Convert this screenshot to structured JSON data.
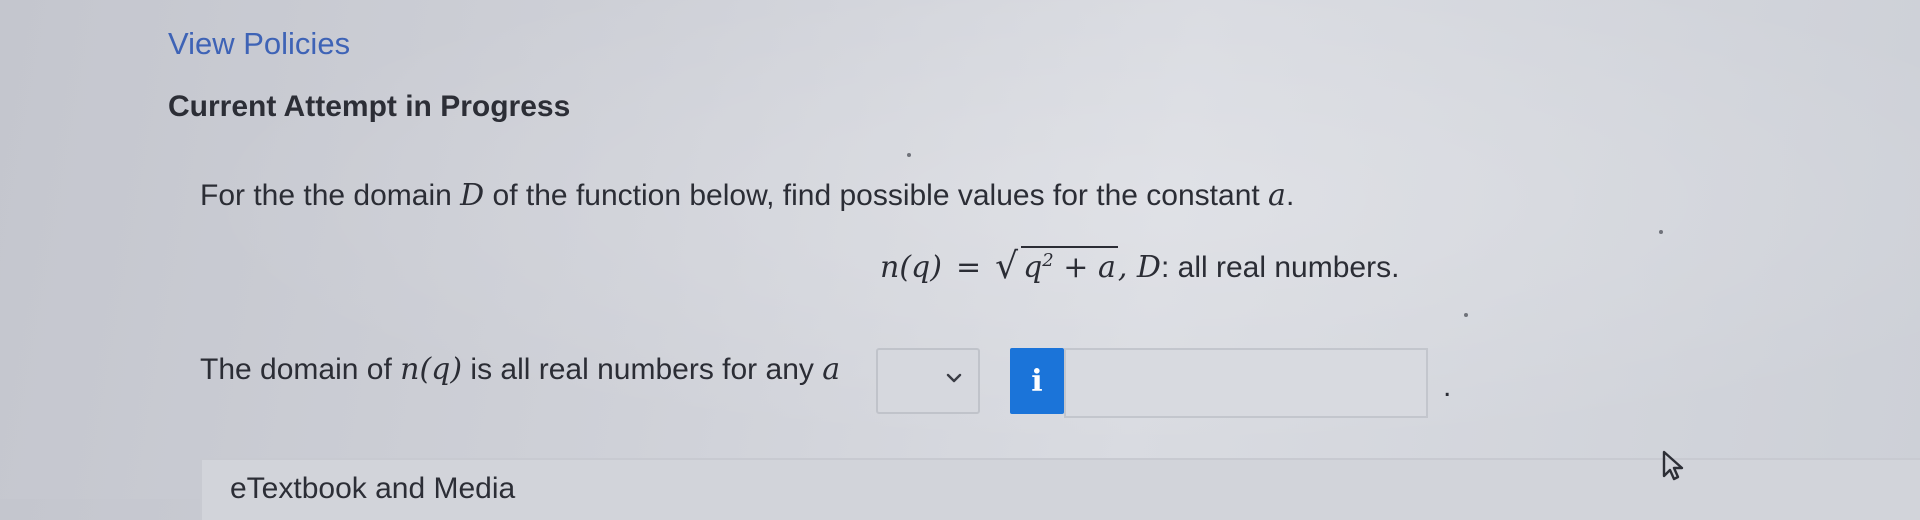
{
  "header": {
    "view_policies_link": "View Policies",
    "attempt_heading": "Current Attempt in Progress"
  },
  "question": {
    "prompt_before_D": "For the the domain ",
    "prompt_var_D": "D",
    "prompt_middle": " of the function below, find possible values for the constant ",
    "prompt_var_a": "a",
    "prompt_end": ".",
    "formula_lhs": "n(q)",
    "formula_eq": "=",
    "radicand_base": "q",
    "radicand_exp": "2",
    "radicand_rest": " + a",
    "formula_domain_var": ", D",
    "formula_domain_text": ": all real numbers."
  },
  "answer": {
    "statement_before": "The domain of ",
    "statement_func": "n(q)",
    "statement_middle": " is all real numbers for any ",
    "statement_var": "a",
    "select_value": "",
    "info_icon_glyph": "i",
    "input_value": "",
    "trailing_period": "."
  },
  "footer": {
    "etextbook_label": "eTextbook and Media"
  },
  "colors": {
    "link": "#3e63b6",
    "info_button": "#1b74d9"
  },
  "icons": {
    "select_caret": "chevron-down-icon",
    "info": "info-icon",
    "pointer": "mouse-cursor-icon"
  }
}
